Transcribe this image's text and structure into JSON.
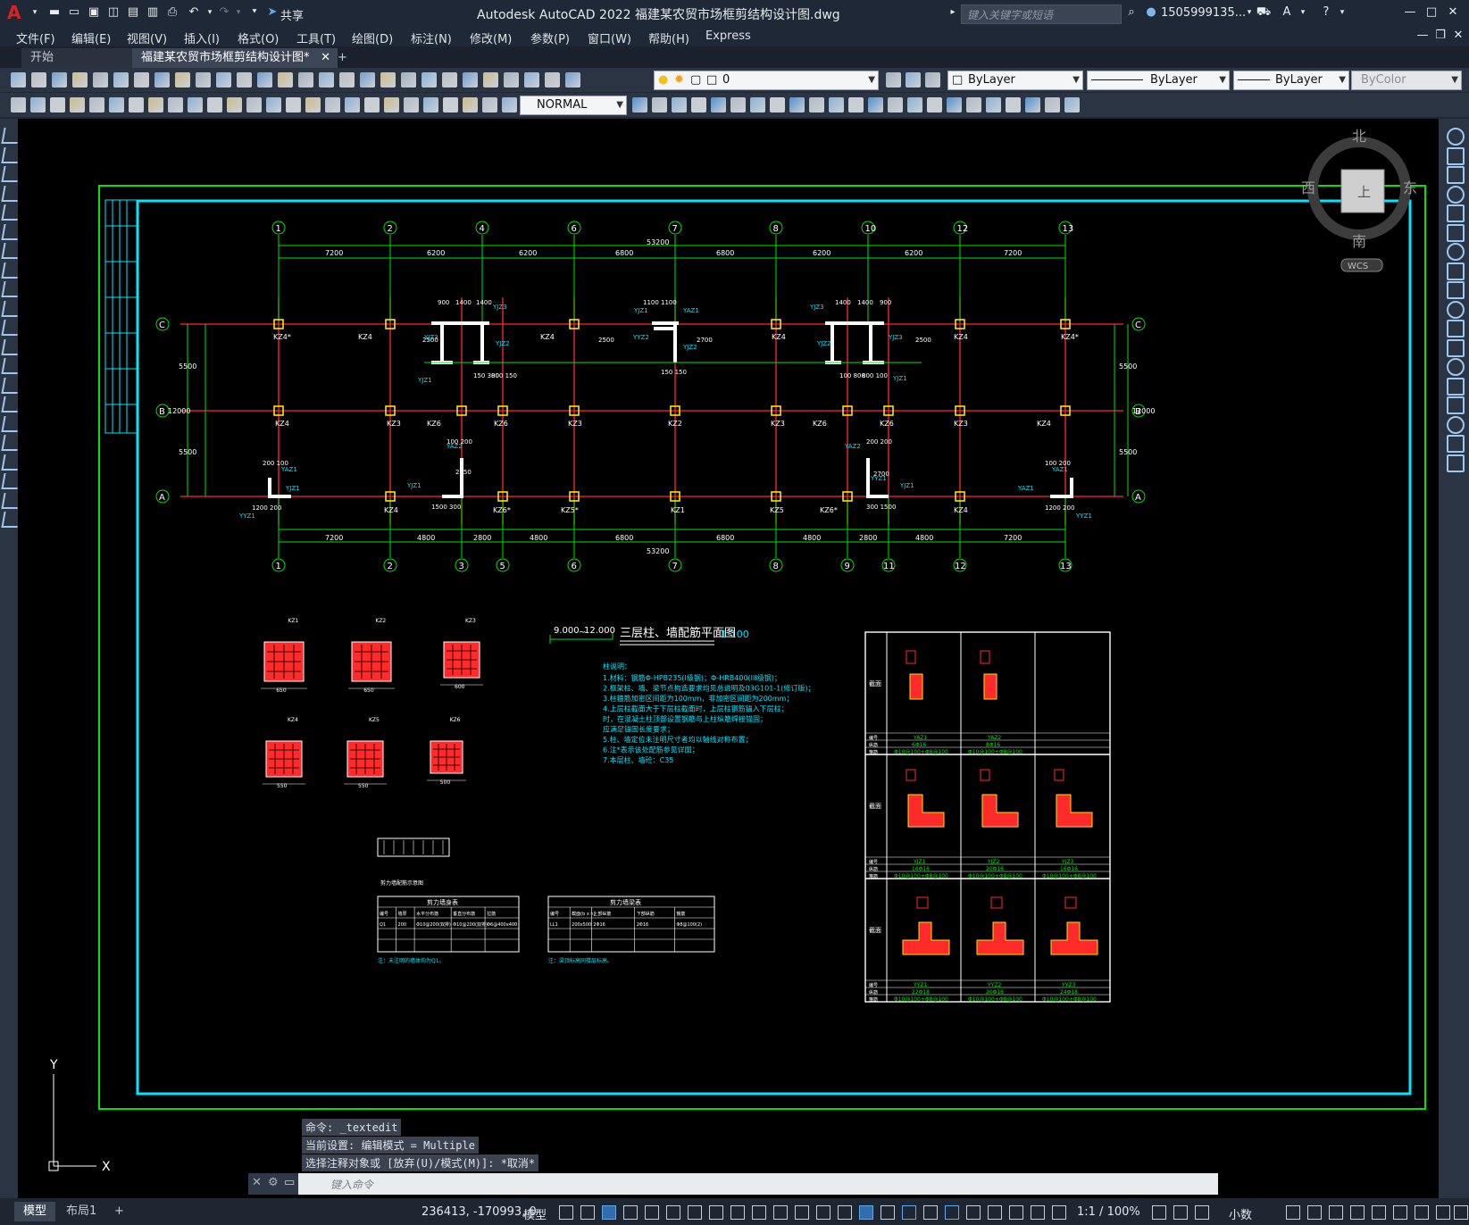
{
  "app": {
    "title": "Autodesk AutoCAD 2022    福建某农贸市场框剪结构设计图.dwg",
    "share_label": "共享",
    "search_placeholder": "键入关键字或短语",
    "user": "1505999135...",
    "accent_color": "#e0201c"
  },
  "menu": [
    "文件(F)",
    "编辑(E)",
    "视图(V)",
    "插入(I)",
    "格式(O)",
    "工具(T)",
    "绘图(D)",
    "标注(N)",
    "修改(M)",
    "参数(P)",
    "窗口(W)",
    "帮助(H)",
    "Express"
  ],
  "tabs": [
    {
      "label": "开始",
      "active": false
    },
    {
      "label": "福建某农贸市场框剪结构设计图*",
      "active": true
    }
  ],
  "toolbar": {
    "layer_value": "0",
    "color_value": "ByLayer",
    "linetype_value": "ByLayer",
    "lineweight_value": "ByLayer",
    "plotstyle_value": "ByColor",
    "textstyle_value": "NORMAL"
  },
  "viewcube": {
    "north": "北",
    "south": "南",
    "east": "东",
    "west": "西",
    "top": "上",
    "wcs": "WCS"
  },
  "drawing": {
    "axes_top": [
      "1",
      "2",
      "4",
      "6",
      "7",
      "8",
      "10",
      "12",
      "13"
    ],
    "axes_bottom": [
      "1",
      "2",
      "3",
      "5",
      "6",
      "7",
      "8",
      "9",
      "11",
      "12",
      "13"
    ],
    "axes_rows": [
      "C",
      "B",
      "A"
    ],
    "dims_top": [
      "7200",
      "6200",
      "6200",
      "6800",
      "6800",
      "6200",
      "6200",
      "7200"
    ],
    "dims_bottom": [
      "7200",
      "4800",
      "2800",
      "4800",
      "6800",
      "6800",
      "4800",
      "2800",
      "4800",
      "7200"
    ],
    "total_dim": "53200",
    "row_dims": [
      "5500",
      "5500"
    ],
    "total_row_dim": "12000",
    "column_labels_c": [
      "KZ4*",
      "KZ4",
      "KZ4",
      "KZ4",
      "KZ4",
      "KZ4*"
    ],
    "column_labels_b": [
      "KZ4",
      "KZ3",
      "KZ6",
      "KZ6",
      "KZ3",
      "KZ2",
      "KZ3",
      "KZ6",
      "KZ6",
      "KZ3",
      "KZ4"
    ],
    "column_labels_a": [
      "KZ4",
      "KZ6*",
      "KZ5*",
      "KZ1",
      "KZ5",
      "KZ6*",
      "KZ4"
    ],
    "plan_title": "三层柱、墙配筋平面图",
    "plan_scale": "1:100",
    "elevation_from": "9.000",
    "elevation_to": "12.000",
    "notes_title": "柱说明：",
    "notes": [
      "1.材料：钢筋Φ-HPB235(I级钢)；Φ-HRB400(III级钢)；",
      "2.框架柱、墙、梁节点构造要求均见总说明及03G101-1(修订版)；",
      "3.柱箍筋加密区间距为100mm，非加密区间距为200mm；",
      "4.上层柱截面大于下层柱截面时，上层柱钢筋锚入下层柱；",
      "  时，在混凝土柱顶部设置钢筋与上柱纵筋焊接锚固；",
      "  应满足锚固长度要求；",
      "5.柱、墙定位未注明尺寸者均以轴线对称布置；",
      "6.注*表示该处配筋参见详图；",
      "7.本层柱、墙砼：C35"
    ],
    "column_sections": [
      {
        "name": "KZ1",
        "width": "650"
      },
      {
        "name": "KZ2",
        "width": "650"
      },
      {
        "name": "KZ3",
        "width": "600"
      },
      {
        "name": "KZ4",
        "width": "550"
      },
      {
        "name": "KZ5",
        "width": "550"
      },
      {
        "name": "KZ6",
        "width": "500"
      }
    ],
    "wall_tables": {
      "left_title": "剪力墙身表",
      "left_headers": [
        "编号",
        "墙厚",
        "水平分布筋",
        "垂直分布筋",
        "拉筋"
      ],
      "left_row": [
        "Q1",
        "200",
        "Φ10@200(双排)",
        "Φ10@200(双排)",
        "Φ6@400x400"
      ],
      "left_note": "注：未注明的墙体均为Q1。",
      "right_title": "剪力墙梁表",
      "right_headers": [
        "编号",
        "截面(b x h)",
        "上部纵筋",
        "下部纵筋",
        "箍筋"
      ],
      "right_row": [
        "LL1",
        "200x500",
        "2Φ16",
        "2Φ16",
        "Φ8@100(2)"
      ],
      "right_note": "注：梁顶标高同楼层标高。",
      "detail_title": "剪力墙配筋示意图"
    },
    "edge_tables": {
      "row1": [
        {
          "name": "YAZ1",
          "bars": "6Φ16",
          "stirrup": "Φ10@100+Φ8@100"
        },
        {
          "name": "YAZ2",
          "bars": "8Φ16",
          "stirrup": "Φ10@100+Φ8@100"
        }
      ],
      "row2": [
        {
          "name": "YJZ1",
          "bars": "16Φ16",
          "stirrup": "Φ10@100+Φ8@100"
        },
        {
          "name": "YJZ2",
          "bars": "20Φ16",
          "stirrup": "Φ10@100+Φ8@100"
        },
        {
          "name": "YJZ3",
          "bars": "16Φ16",
          "stirrup": "Φ10@100+Φ8@100"
        }
      ],
      "row3": [
        {
          "name": "YYZ1",
          "bars": "22Φ18",
          "stirrup": "Φ10@100+Φ8@100"
        },
        {
          "name": "YYZ2",
          "bars": "20Φ16",
          "stirrup": "Φ10@100+Φ8@100"
        },
        {
          "name": "YYZ3",
          "bars": "24Φ18",
          "stirrup": "Φ10@100+Φ8@100"
        }
      ],
      "row_label_section": "截面",
      "row_label_name": "编号",
      "row_label_bars": "纵筋",
      "row_label_stirrup": "箍筋"
    }
  },
  "command": {
    "history": [
      "命令: _textedit",
      "当前设置: 编辑模式 = Multiple",
      "选择注释对象或 [放弃(U)/模式(M)]: *取消*"
    ],
    "placeholder": "键入命令"
  },
  "status": {
    "layouts": [
      "模型",
      "布局1"
    ],
    "coords": "236413, -170993, 0",
    "model_label": "模型",
    "scale": "1:1 / 100%",
    "units": "小数"
  },
  "ucs": {
    "x": "X",
    "y": "Y"
  }
}
